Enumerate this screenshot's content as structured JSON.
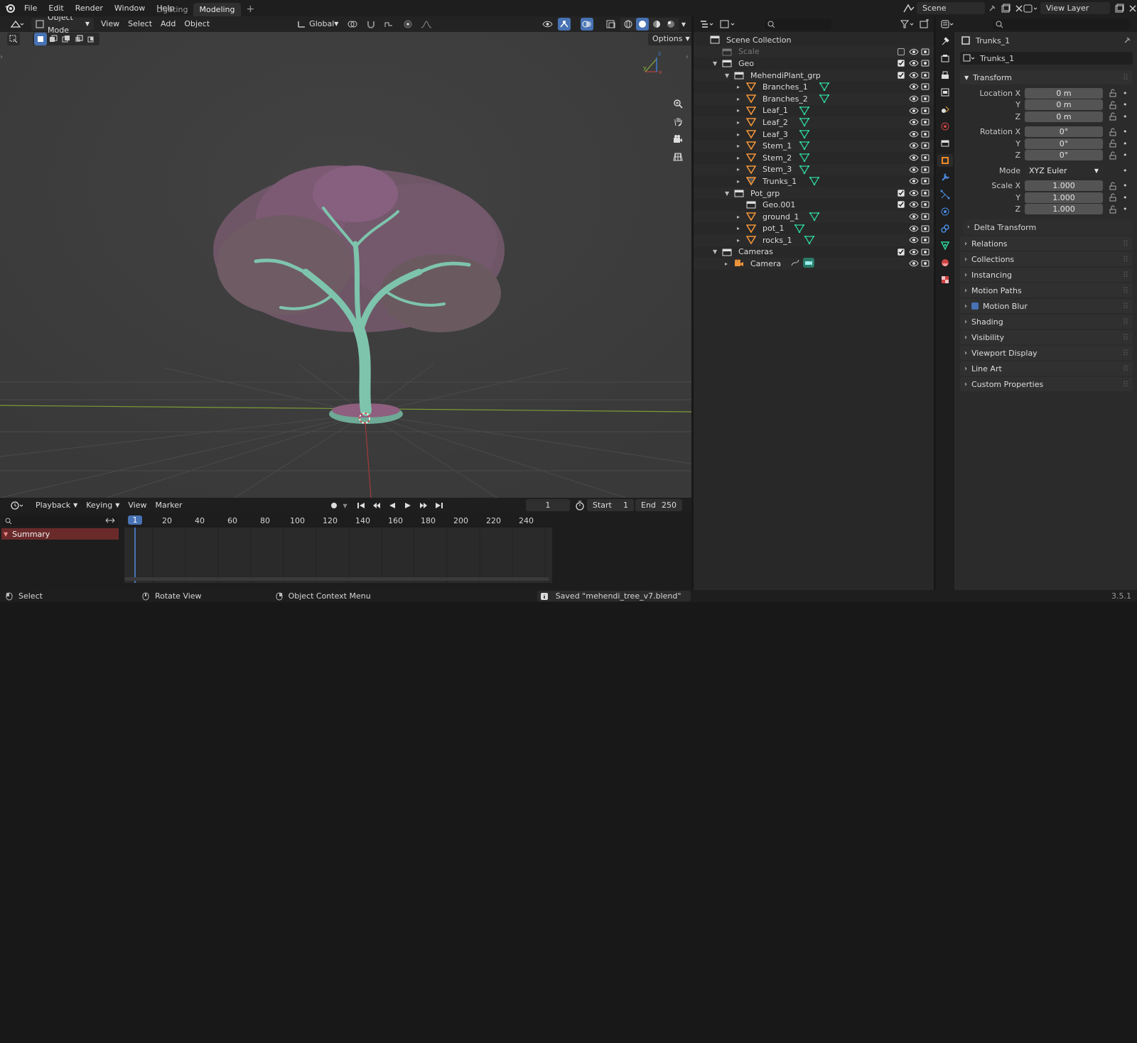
{
  "topbar": {
    "menus": [
      "File",
      "Edit",
      "Render",
      "Window",
      "Help"
    ],
    "workspaces": [
      "Lighting",
      "Modeling"
    ],
    "active_workspace": "Modeling",
    "add_tab": "+",
    "scene_name": "Scene",
    "view_layer": "View Layer"
  },
  "viewport": {
    "mode": "Object Mode",
    "menus": [
      "View",
      "Select",
      "Add",
      "Object"
    ],
    "transform_orientation": "Global",
    "options_label": "Options",
    "gizmo": {
      "x": "x",
      "y": "y",
      "z": "z"
    },
    "colors": {
      "bg": "#3d3d3d",
      "trunk": "#7ec4ad",
      "leaves": "#8a5a78",
      "x_axis": "#8fb53a",
      "z_axis": "#b03a3a"
    }
  },
  "timeline": {
    "menus": [
      "Playback",
      "Keying",
      "View",
      "Marker"
    ],
    "current_frame": "1",
    "start_label": "Start",
    "start": "1",
    "end_label": "End",
    "end": "250",
    "channel": "Summary",
    "ticks": [
      "1",
      "20",
      "40",
      "60",
      "80",
      "100",
      "120",
      "140",
      "160",
      "180",
      "200",
      "220",
      "240"
    ]
  },
  "outliner": {
    "search_placeholder": "",
    "rows": [
      {
        "label": "Scene Collection",
        "depth": 0,
        "type": "scene",
        "expander": "",
        "check": false,
        "eye": false,
        "cam": false,
        "mesh": false
      },
      {
        "label": "Scale",
        "depth": 1,
        "type": "collection-dim",
        "expander": "",
        "check": "off",
        "eye": true,
        "cam": true,
        "mesh": false
      },
      {
        "label": "Geo",
        "depth": 1,
        "type": "collection",
        "expander": "▼",
        "check": "on",
        "eye": true,
        "cam": true,
        "mesh": false
      },
      {
        "label": "MehendiPlant_grp",
        "depth": 2,
        "type": "collection",
        "expander": "▼",
        "check": "on",
        "eye": true,
        "cam": true,
        "mesh": false
      },
      {
        "label": "Branches_1",
        "depth": 3,
        "type": "mesh",
        "expander": "▸",
        "check": false,
        "eye": true,
        "cam": true,
        "mesh": true
      },
      {
        "label": "Branches_2",
        "depth": 3,
        "type": "mesh",
        "expander": "▸",
        "check": false,
        "eye": true,
        "cam": true,
        "mesh": true
      },
      {
        "label": "Leaf_1",
        "depth": 3,
        "type": "mesh",
        "expander": "▸",
        "check": false,
        "eye": true,
        "cam": true,
        "mesh": true
      },
      {
        "label": "Leaf_2",
        "depth": 3,
        "type": "mesh",
        "expander": "▸",
        "check": false,
        "eye": true,
        "cam": true,
        "mesh": true
      },
      {
        "label": "Leaf_3",
        "depth": 3,
        "type": "mesh",
        "expander": "▸",
        "check": false,
        "eye": true,
        "cam": true,
        "mesh": true
      },
      {
        "label": "Stem_1",
        "depth": 3,
        "type": "mesh",
        "expander": "▸",
        "check": false,
        "eye": true,
        "cam": true,
        "mesh": true
      },
      {
        "label": "Stem_2",
        "depth": 3,
        "type": "mesh",
        "expander": "▸",
        "check": false,
        "eye": true,
        "cam": true,
        "mesh": true
      },
      {
        "label": "Stem_3",
        "depth": 3,
        "type": "mesh",
        "expander": "▸",
        "check": false,
        "eye": true,
        "cam": true,
        "mesh": true
      },
      {
        "label": "Trunks_1",
        "depth": 3,
        "type": "mesh-active",
        "expander": "▸",
        "check": false,
        "eye": true,
        "cam": true,
        "mesh": true
      },
      {
        "label": "Pot_grp",
        "depth": 2,
        "type": "collection",
        "expander": "▼",
        "check": "on",
        "eye": true,
        "cam": true,
        "mesh": false
      },
      {
        "label": "Geo.001",
        "depth": 3,
        "type": "collection",
        "expander": "",
        "check": "on",
        "eye": true,
        "cam": true,
        "mesh": false
      },
      {
        "label": "ground_1",
        "depth": 3,
        "type": "mesh",
        "expander": "▸",
        "check": false,
        "eye": true,
        "cam": true,
        "mesh": true
      },
      {
        "label": "pot_1",
        "depth": 3,
        "type": "mesh",
        "expander": "▸",
        "check": false,
        "eye": true,
        "cam": true,
        "mesh": true
      },
      {
        "label": "rocks_1",
        "depth": 3,
        "type": "mesh",
        "expander": "▸",
        "check": false,
        "eye": true,
        "cam": true,
        "mesh": true
      },
      {
        "label": "Cameras",
        "depth": 1,
        "type": "collection",
        "expander": "▼",
        "check": "on",
        "eye": true,
        "cam": true,
        "mesh": false
      },
      {
        "label": "Camera",
        "depth": 2,
        "type": "camera",
        "expander": "▸",
        "check": false,
        "eye": true,
        "cam": true,
        "mesh": false
      }
    ]
  },
  "properties": {
    "object_name": "Trunks_1",
    "name_field": "Trunks_1",
    "transform_title": "Transform",
    "location_label": "Location X",
    "location": [
      "0 m",
      "0 m",
      "0 m"
    ],
    "rotation_label": "Rotation X",
    "rotation": [
      "0°",
      "0°",
      "0°"
    ],
    "mode_label": "Mode",
    "mode_value": "XYZ Euler",
    "scale_label": "Scale X",
    "scale": [
      "1.000",
      "1.000",
      "1.000"
    ],
    "axis_y": "Y",
    "axis_z": "Z",
    "delta_transform": "Delta Transform",
    "panels": [
      "Relations",
      "Collections",
      "Instancing",
      "Motion Paths",
      "Motion Blur",
      "Shading",
      "Visibility",
      "Viewport Display",
      "Line Art",
      "Custom Properties"
    ]
  },
  "statusbar": {
    "select": "Select",
    "rotate": "Rotate View",
    "context": "Object Context Menu",
    "message": "Saved \"mehendi_tree_v7.blend\"",
    "version": "3.5.1"
  }
}
